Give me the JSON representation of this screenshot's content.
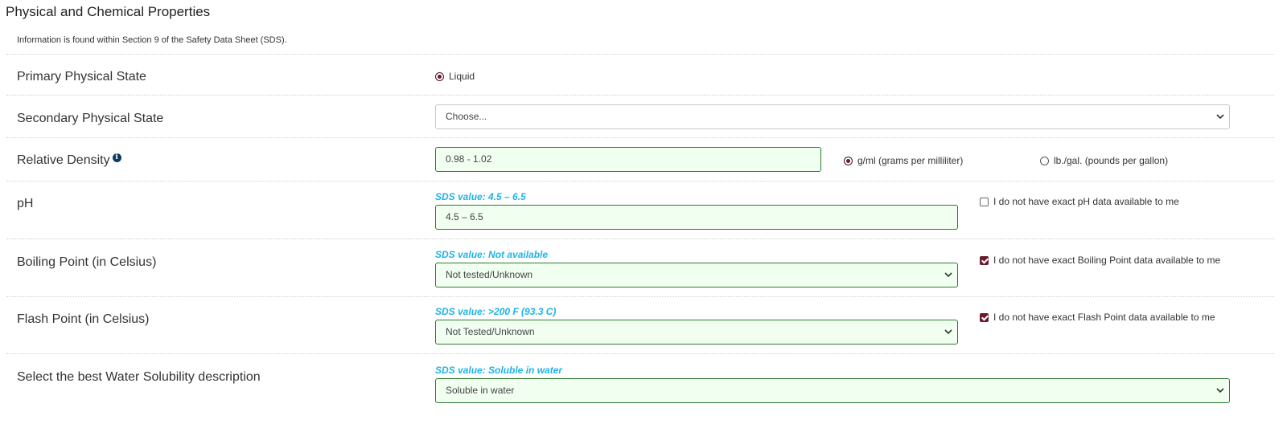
{
  "section": {
    "title": "Physical and Chemical Properties",
    "info": "Information is found within Section 9 of the Safety Data Sheet (SDS)."
  },
  "primary_state": {
    "label": "Primary Physical State",
    "option": "Liquid",
    "selected": true
  },
  "secondary_state": {
    "label": "Secondary Physical State",
    "value": "Choose..."
  },
  "relative_density": {
    "label": "Relative Density",
    "info_icon": "info-circle-icon",
    "value": "0.98 - 1.02",
    "unit_options": [
      {
        "label": "g/ml (grams per milliliter)",
        "selected": true
      },
      {
        "label": "lb./gal. (pounds per gallon)",
        "selected": false
      }
    ]
  },
  "ph": {
    "label": "pH",
    "sds_value": "SDS value: 4.5 – 6.5",
    "value": "4.5 – 6.5",
    "no_data_label": "I do not have exact pH data available to me",
    "no_data_checked": false
  },
  "boiling_point": {
    "label": "Boiling Point (in Celsius)",
    "sds_value": "SDS value: Not available",
    "value": "Not tested/Unknown",
    "no_data_label": "I do not have exact Boiling Point data available to me",
    "no_data_checked": true
  },
  "flash_point": {
    "label": "Flash Point (in Celsius)",
    "sds_value": "SDS value: >200 F (93.3 C)",
    "value": "Not Tested/Unknown",
    "no_data_label": "I do not have exact Flash Point data available to me",
    "no_data_checked": true
  },
  "water_solubility": {
    "label": "Select the best Water Solubility description",
    "sds_value": "SDS value: Soluble in water",
    "value": "Soluble in water"
  },
  "colors": {
    "valid_border": "#2d7a2d",
    "valid_bg": "#f1fff1",
    "sds_hint": "#1fb3e6",
    "checked": "#6b1a2b"
  }
}
